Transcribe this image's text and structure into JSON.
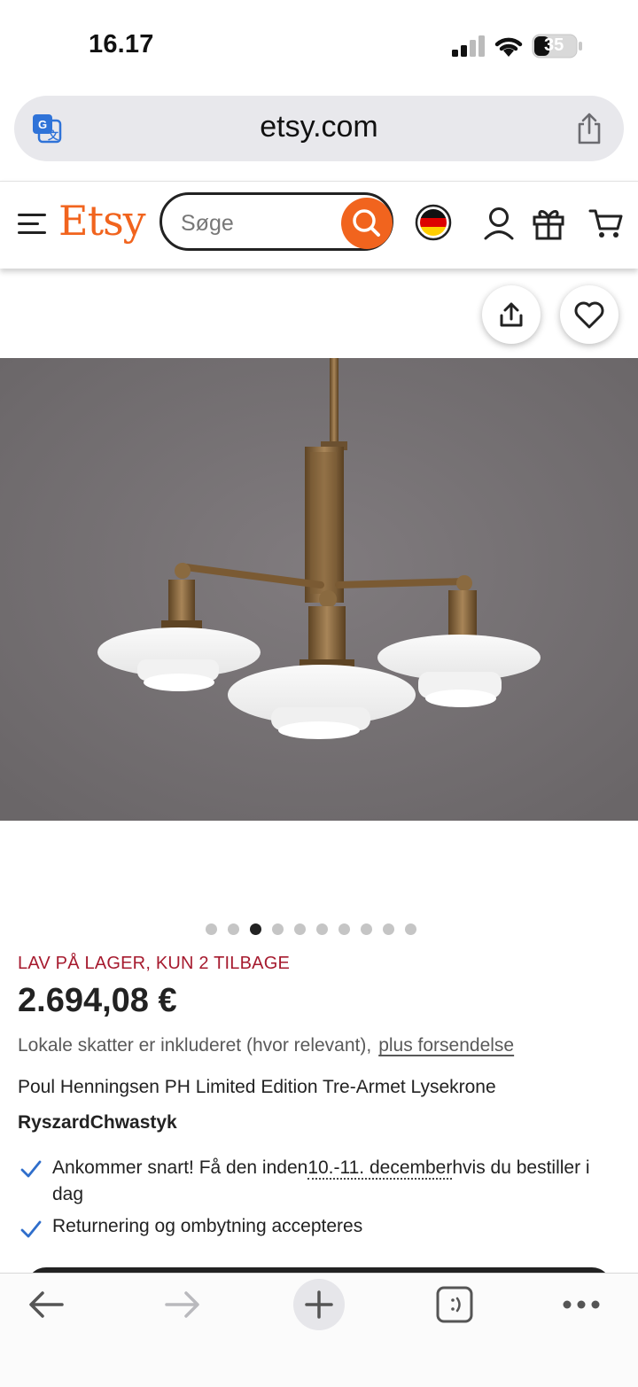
{
  "status_bar": {
    "time": "16.17",
    "battery": "35"
  },
  "browser": {
    "url": "etsy.com"
  },
  "header": {
    "logo": "Etsy",
    "search_placeholder": "Søge"
  },
  "product": {
    "image_dots": {
      "count": 10,
      "active_index": 2
    },
    "stock_text": "LAV PÅ LAGER, KUN 2 TILBAGE",
    "price": "2.694,08 €",
    "tax_text": "Lokale skatter er inkluderet (hvor relevant),",
    "shipping_link": "plus forsendelse",
    "title": "Poul Henningsen PH Limited Edition Tre-Armet Lysekrone",
    "seller": "RyszardChwastyk",
    "delivery_pre": "Ankommer snart! Få den inden",
    "delivery_date": "10.-11. december",
    "delivery_post": "hvis du bestiller i dag",
    "returns_text": "Returnering og ombytning accepteres"
  },
  "colors": {
    "etsy_orange": "#f1641e",
    "stock_red": "#a61a2e",
    "check_blue": "#2f6ecb"
  },
  "icons": [
    "translate-icon",
    "share-icon",
    "menu-icon",
    "search-icon",
    "germany-flag-icon",
    "account-icon",
    "gift-icon",
    "cart-icon",
    "heart-icon",
    "checkmark-icon",
    "back-arrow-icon",
    "forward-arrow-icon",
    "plus-icon",
    "tabs-icon",
    "more-icon"
  ]
}
